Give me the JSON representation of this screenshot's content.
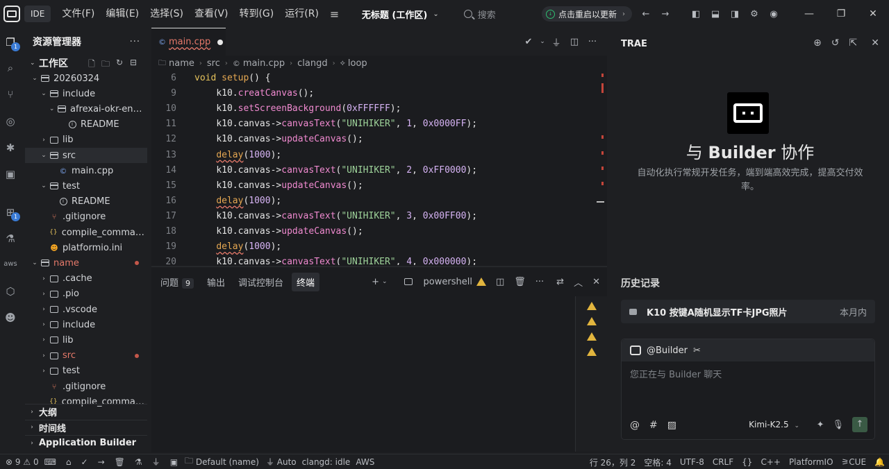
{
  "titlebar": {
    "app_badge": "IDE",
    "menu": [
      "文件(F)",
      "编辑(E)",
      "选择(S)",
      "查看(V)",
      "转到(G)",
      "运行(R)"
    ],
    "workspace_title": "无标题 (工作区)",
    "search_placeholder": "搜索",
    "update_label": "点击重启以更新"
  },
  "activity": {
    "explorer_badge": "1",
    "extensions_badge": "1",
    "aws_label": "aws"
  },
  "sidebar": {
    "title": "资源管理器",
    "workspace_label": "工作区",
    "tree": [
      {
        "name": "20260324",
        "type": "folder-open",
        "indent": 0
      },
      {
        "name": "include",
        "type": "folder-open",
        "indent": 1
      },
      {
        "name": "afrexai-okr-engi...",
        "type": "folder-open",
        "indent": 2
      },
      {
        "name": "README",
        "type": "info",
        "indent": 3
      },
      {
        "name": "lib",
        "type": "folder",
        "indent": 1
      },
      {
        "name": "src",
        "type": "folder-open",
        "indent": 1,
        "selected": true
      },
      {
        "name": "main.cpp",
        "type": "cpp",
        "indent": 2
      },
      {
        "name": "test",
        "type": "folder-open",
        "indent": 1
      },
      {
        "name": "README",
        "type": "info",
        "indent": 2
      },
      {
        "name": ".gitignore",
        "type": "git",
        "indent": 1
      },
      {
        "name": "compile_comman...",
        "type": "json",
        "indent": 1
      },
      {
        "name": "platformio.ini",
        "type": "pio",
        "indent": 1
      },
      {
        "name": "name",
        "type": "folder-open",
        "indent": 0,
        "modified": true
      },
      {
        "name": ".cache",
        "type": "folder",
        "indent": 1
      },
      {
        "name": ".pio",
        "type": "folder",
        "indent": 1
      },
      {
        "name": ".vscode",
        "type": "folder",
        "indent": 1
      },
      {
        "name": "include",
        "type": "folder",
        "indent": 1
      },
      {
        "name": "lib",
        "type": "folder",
        "indent": 1
      },
      {
        "name": "src",
        "type": "folder",
        "indent": 1,
        "modified": true
      },
      {
        "name": "test",
        "type": "folder",
        "indent": 1
      },
      {
        "name": ".gitignore",
        "type": "git",
        "indent": 1
      },
      {
        "name": "compile_comman...",
        "type": "json",
        "indent": 1
      }
    ],
    "sections": [
      "大纲",
      "时间线",
      "Application Builder"
    ]
  },
  "editor": {
    "tab_name": "main.cpp",
    "breadcrumb": [
      "name",
      "src",
      "main.cpp",
      "clangd",
      "loop"
    ],
    "lines": [
      {
        "n": "6",
        "tokens": [
          [
            "k",
            "void "
          ],
          [
            "fn",
            "setup"
          ],
          [
            "p",
            "() {"
          ]
        ]
      },
      {
        "n": "9",
        "tokens": [
          [
            "p",
            "    "
          ],
          [
            "id",
            "k10"
          ],
          [
            "p",
            "."
          ],
          [
            "m",
            "creatCanvas"
          ],
          [
            "p",
            "();"
          ]
        ]
      },
      {
        "n": "10",
        "tokens": [
          [
            "p",
            "    "
          ],
          [
            "id",
            "k10"
          ],
          [
            "p",
            "."
          ],
          [
            "m",
            "setScreenBackground"
          ],
          [
            "p",
            "("
          ],
          [
            "n",
            "0xFFFFFF"
          ],
          [
            "p",
            ");"
          ]
        ]
      },
      {
        "n": "11",
        "tokens": [
          [
            "p",
            "    "
          ],
          [
            "id",
            "k10"
          ],
          [
            "p",
            ".canvas->"
          ],
          [
            "m",
            "canvasText"
          ],
          [
            "p",
            "("
          ],
          [
            "s",
            "\"UNIHIKER\""
          ],
          [
            "p",
            ", "
          ],
          [
            "n",
            "1"
          ],
          [
            "p",
            ", "
          ],
          [
            "n",
            "0x0000FF"
          ],
          [
            "p",
            ");"
          ]
        ]
      },
      {
        "n": "12",
        "tokens": [
          [
            "p",
            "    "
          ],
          [
            "id",
            "k10"
          ],
          [
            "p",
            ".canvas->"
          ],
          [
            "m",
            "updateCanvas"
          ],
          [
            "p",
            "();"
          ]
        ]
      },
      {
        "n": "13",
        "tokens": [
          [
            "p",
            "    "
          ],
          [
            "fnsq",
            "delay"
          ],
          [
            "p",
            "("
          ],
          [
            "n",
            "1000"
          ],
          [
            "p",
            ");"
          ]
        ]
      },
      {
        "n": "14",
        "tokens": [
          [
            "p",
            "    "
          ],
          [
            "id",
            "k10"
          ],
          [
            "p",
            ".canvas->"
          ],
          [
            "m",
            "canvasText"
          ],
          [
            "p",
            "("
          ],
          [
            "s",
            "\"UNIHIKER\""
          ],
          [
            "p",
            ", "
          ],
          [
            "n",
            "2"
          ],
          [
            "p",
            ", "
          ],
          [
            "n",
            "0xFF0000"
          ],
          [
            "p",
            ");"
          ]
        ]
      },
      {
        "n": "15",
        "tokens": [
          [
            "p",
            "    "
          ],
          [
            "id",
            "k10"
          ],
          [
            "p",
            ".canvas->"
          ],
          [
            "m",
            "updateCanvas"
          ],
          [
            "p",
            "();"
          ]
        ]
      },
      {
        "n": "16",
        "tokens": [
          [
            "p",
            "    "
          ],
          [
            "fnsq",
            "delay"
          ],
          [
            "p",
            "("
          ],
          [
            "n",
            "1000"
          ],
          [
            "p",
            ");"
          ]
        ]
      },
      {
        "n": "17",
        "tokens": [
          [
            "p",
            "    "
          ],
          [
            "id",
            "k10"
          ],
          [
            "p",
            ".canvas->"
          ],
          [
            "m",
            "canvasText"
          ],
          [
            "p",
            "("
          ],
          [
            "s",
            "\"UNIHIKER\""
          ],
          [
            "p",
            ", "
          ],
          [
            "n",
            "3"
          ],
          [
            "p",
            ", "
          ],
          [
            "n",
            "0x00FF00"
          ],
          [
            "p",
            ");"
          ]
        ]
      },
      {
        "n": "18",
        "tokens": [
          [
            "p",
            "    "
          ],
          [
            "id",
            "k10"
          ],
          [
            "p",
            ".canvas->"
          ],
          [
            "m",
            "updateCanvas"
          ],
          [
            "p",
            "();"
          ]
        ]
      },
      {
        "n": "19",
        "tokens": [
          [
            "p",
            "    "
          ],
          [
            "fnsq",
            "delay"
          ],
          [
            "p",
            "("
          ],
          [
            "n",
            "1000"
          ],
          [
            "p",
            ");"
          ]
        ]
      },
      {
        "n": "20",
        "tokens": [
          [
            "p",
            "    "
          ],
          [
            "id",
            "k10"
          ],
          [
            "p",
            ".canvas->"
          ],
          [
            "m",
            "canvasText"
          ],
          [
            "p",
            "("
          ],
          [
            "s",
            "\"UNIHIKER\""
          ],
          [
            "p",
            ", "
          ],
          [
            "n",
            "4"
          ],
          [
            "p",
            ", "
          ],
          [
            "n",
            "0x000000"
          ],
          [
            "p",
            ");"
          ]
        ]
      }
    ]
  },
  "panel": {
    "tabs": [
      {
        "label": "问题",
        "count": "9"
      },
      {
        "label": "输出"
      },
      {
        "label": "调试控制台"
      },
      {
        "label": "终端",
        "active": true
      }
    ],
    "terminal_name": "powershell",
    "warning_count": 4
  },
  "chat": {
    "title": "TRAE",
    "heading_prefix": "与 ",
    "heading_bold": "Builder",
    "heading_suffix": " 协作",
    "subtitle": "自动化执行常规开发任务，端到端高效完成，提高交付效率。",
    "history_label": "历史记录",
    "history_item_title": "K10 按键A随机显示TF卡JPG照片",
    "history_item_date": "本月内",
    "agent_label": "@Builder",
    "input_placeholder": "您正在与 Builder 聊天",
    "model": "Kimi-K2.5"
  },
  "statusbar": {
    "errors": "9",
    "warnings": "0",
    "env": "Default (name)",
    "auto": "Auto",
    "clangd": "clangd: idle",
    "aws": "AWS",
    "position": "行 26，列 2",
    "spaces": "空格: 4",
    "encoding": "UTF-8",
    "eol": "CRLF",
    "language": "C++",
    "platform": "PlatformIO",
    "cue": "CUE"
  },
  "colors": {
    "accent_green": "#2fbf71",
    "error_red": "#c4453a",
    "warning_yellow": "#e2b53e",
    "modified_text": "#e5796a"
  }
}
